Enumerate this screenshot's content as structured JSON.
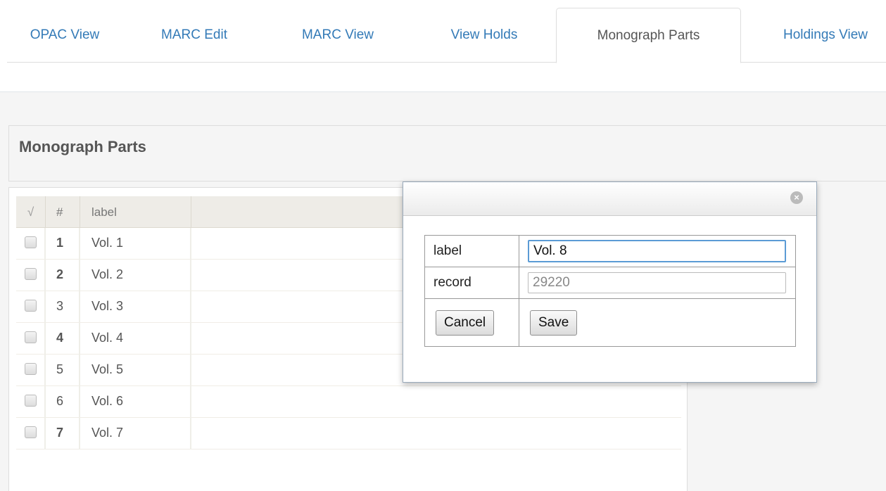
{
  "tabs": [
    {
      "label": "OPAC View",
      "active": false
    },
    {
      "label": "MARC Edit",
      "active": false
    },
    {
      "label": "MARC View",
      "active": false
    },
    {
      "label": "View Holds",
      "active": false
    },
    {
      "label": "Monograph Parts",
      "active": true
    },
    {
      "label": "Holdings View",
      "active": false
    }
  ],
  "panel": {
    "title": "Monograph Parts"
  },
  "grid": {
    "columns": {
      "check": "√",
      "num": "#",
      "label": "label"
    },
    "rows": [
      {
        "num": "1",
        "label": "Vol. 1"
      },
      {
        "num": "2",
        "label": "Vol. 2"
      },
      {
        "num": "3",
        "label": "Vol. 3"
      },
      {
        "num": "4",
        "label": "Vol. 4"
      },
      {
        "num": "5",
        "label": "Vol. 5"
      },
      {
        "num": "6",
        "label": "Vol. 6"
      },
      {
        "num": "7",
        "label": "Vol. 7"
      }
    ]
  },
  "dialog": {
    "close_icon": "close-circle-icon",
    "label_field_label": "label",
    "label_value": "Vol. 8",
    "record_field_label": "record",
    "record_value": "29220",
    "cancel_label": "Cancel",
    "save_label": "Save"
  },
  "colors": {
    "link": "#337ab7",
    "focus_border": "#5b9bd5",
    "grid_header": "#eeece7"
  }
}
